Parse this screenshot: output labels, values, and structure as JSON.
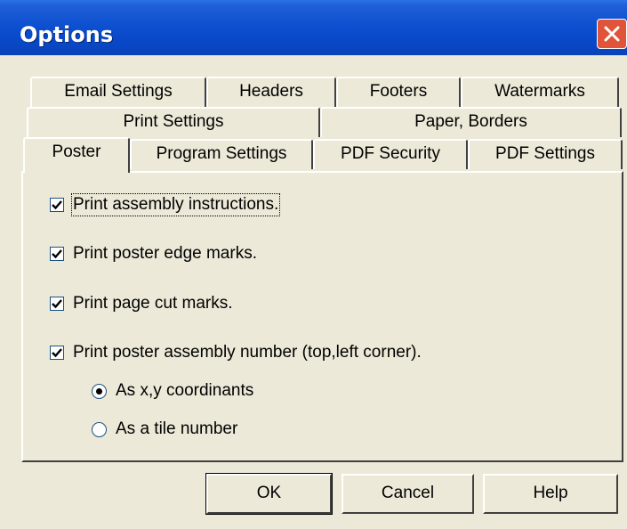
{
  "window": {
    "title": "Options",
    "close_icon": "close-icon"
  },
  "tabs": {
    "row1": [
      {
        "label": "Email Settings"
      },
      {
        "label": "Headers"
      },
      {
        "label": "Footers"
      },
      {
        "label": "Watermarks"
      }
    ],
    "row2": [
      {
        "label": "Print Settings"
      },
      {
        "label": "Paper, Borders"
      }
    ],
    "row3": [
      {
        "label": "Poster",
        "active": true
      },
      {
        "label": "Program Settings"
      },
      {
        "label": "PDF Security"
      },
      {
        "label": "PDF Settings"
      }
    ]
  },
  "poster": {
    "options": [
      {
        "label": "Print assembly instructions.",
        "checked": true
      },
      {
        "label": "Print poster edge marks.",
        "checked": true
      },
      {
        "label": "Print page cut marks.",
        "checked": true
      },
      {
        "label": "Print poster assembly number (top,left corner).",
        "checked": true
      }
    ],
    "number_format": [
      {
        "label": "As x,y coordinants",
        "selected": true
      },
      {
        "label": "As a tile number",
        "selected": false
      }
    ]
  },
  "buttons": {
    "ok": "OK",
    "cancel": "Cancel",
    "help": "Help"
  },
  "colors": {
    "titlebar": "#0b4ecf",
    "close_button": "#e0553a",
    "dialog_face": "#ece9d8"
  }
}
